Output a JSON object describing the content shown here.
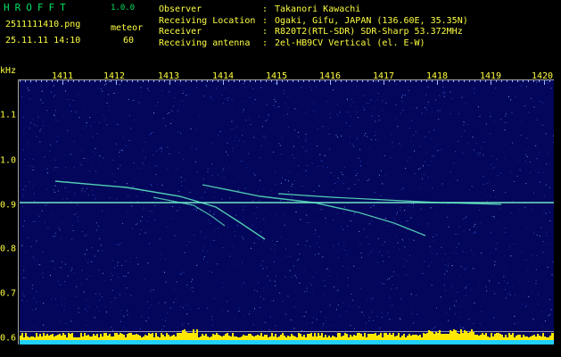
{
  "app": {
    "title": "HROFFT",
    "version": "1.0.0"
  },
  "file": {
    "name": "2511111410.png",
    "datetime": "25.11.11 14:10"
  },
  "mode": {
    "label": "meteor",
    "value": "60"
  },
  "info": [
    {
      "key": "Observer",
      "sep": ":",
      "value": "Takanori Kawachi"
    },
    {
      "key": "Receiving Location",
      "sep": ":",
      "value": "Ogaki, Gifu, JAPAN (136.60E, 35.35N)"
    },
    {
      "key": "Receiver",
      "sep": ":",
      "value": "R820T2(RTL-SDR) SDR-Sharp 53.372MHz"
    },
    {
      "key": "Receiving antenna",
      "sep": ":",
      "value": "2el-HB9CV Vertical (el. E-W)"
    }
  ],
  "axis": {
    "y_unit": "kHz",
    "x_ticks": [
      "1411",
      "1412",
      "1413",
      "1414",
      "1415",
      "1416",
      "1417",
      "1418",
      "1419",
      "1420"
    ],
    "y_ticks": [
      "1.1",
      "1.0",
      "0.9",
      "0.8",
      "0.7",
      "0.6"
    ]
  },
  "colors": {
    "background": "#000000",
    "plot": "#03065a",
    "label": "#ffff40",
    "title": "#00e060",
    "trace": "#66ffcc",
    "bar": "#ffe800",
    "bar_base": "#20d0ff"
  }
}
